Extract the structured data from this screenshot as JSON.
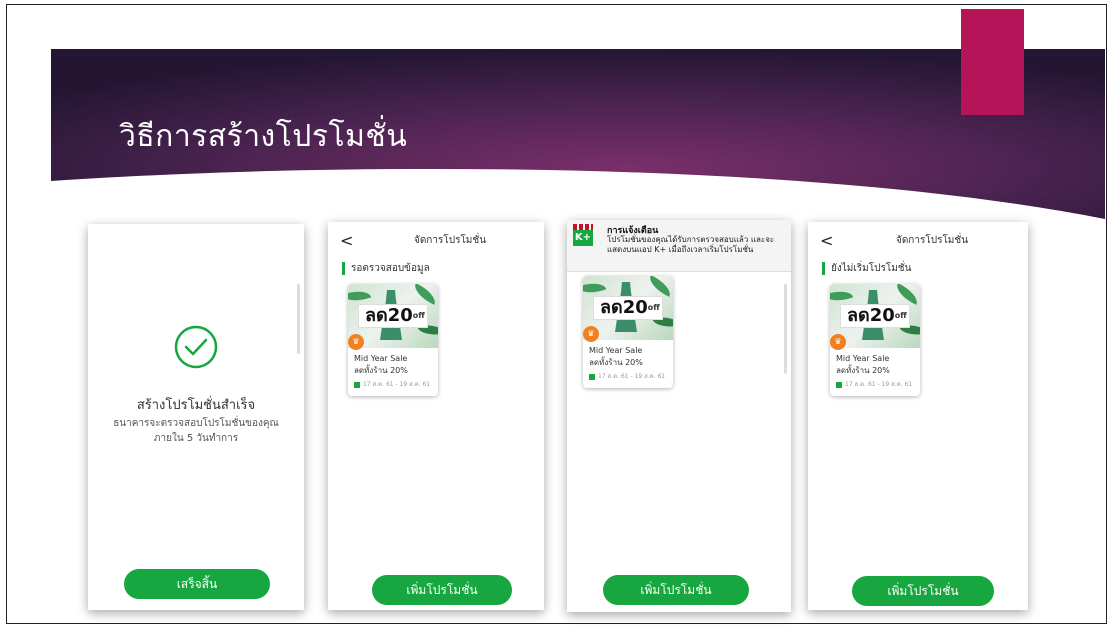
{
  "slide": {
    "title": "วิธีการสร้างโปรโมชั่น",
    "colors": {
      "banner_dark": "#2a1738",
      "banner_mid": "#6a2c5e",
      "accent": "#b51458",
      "green": "#17a63f"
    }
  },
  "screen1": {
    "success_title": "สร้างโปรโมชั่นสำเร็จ",
    "success_line1": "ธนาคารจะตรวจสอบโปรโมชั่นของคุณ",
    "success_line2": "ภายใน 5 วันทำการ",
    "done_button": "เสร็จสิ้น",
    "icon": "check-circle-icon"
  },
  "screen2": {
    "back_icon": "<",
    "header_title": "จัดการโปรโมชั่น",
    "section_label": "รอตรวจสอบข้อมูล",
    "card": {
      "sale_text": "ลด",
      "sale_number": "20",
      "sale_suffix": "off",
      "name": "Mid Year Sale",
      "desc": "ลดทั้งร้าน 20%",
      "date": "17 ส.ค. 61 - 19 ส.ค. 61"
    },
    "add_button": "เพิ่มโปรโมชั่น"
  },
  "screen3": {
    "notif_logo": "K+",
    "notif_title": "การแจ้งเตือน",
    "notif_body": "โปรโมชั่นของคุณได้รับการตรวจสอบแล้ว และจะแสดงบนแอป K+ เมื่อถึงเวลาเริ่มโปรโมชั่น",
    "card": {
      "sale_text": "ลด",
      "sale_number": "20",
      "sale_suffix": "off",
      "name": "Mid Year Sale",
      "desc": "ลดทั้งร้าน 20%",
      "date": "17 ส.ค. 61 - 19 ส.ค. 61"
    },
    "add_button": "เพิ่มโปรโมชั่น"
  },
  "screen4": {
    "back_icon": "<",
    "header_title": "จัดการโปรโมชั่น",
    "section_label": "ยังไม่เริ่มโปรโมชั่น",
    "card": {
      "sale_text": "ลด",
      "sale_number": "20",
      "sale_suffix": "off",
      "name": "Mid Year Sale",
      "desc": "ลดทั้งร้าน 20%",
      "date": "17 ส.ค. 61 - 19 ส.ค. 61"
    },
    "add_button": "เพิ่มโปรโมชั่น"
  }
}
